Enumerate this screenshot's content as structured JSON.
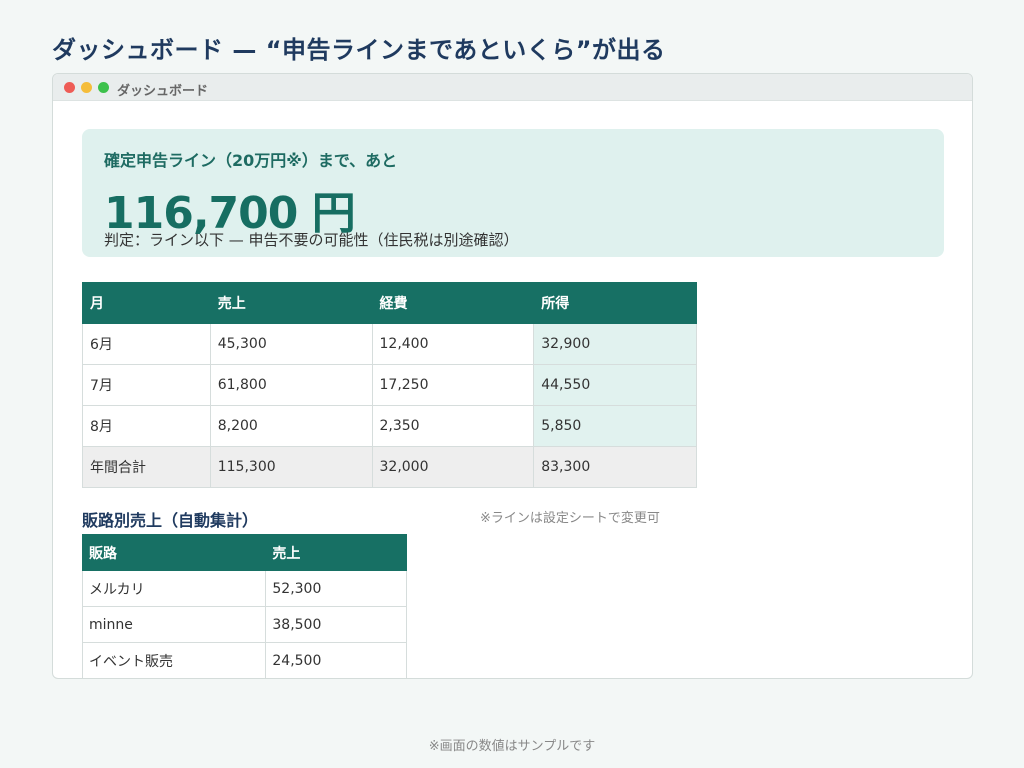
{
  "page_title": "ダッシュボード — “申告ラインまであといくら”が出る",
  "window": {
    "title": "ダッシュボード"
  },
  "summary": {
    "heading": "確定申告ライン（20万円※）まで、あと",
    "amount": "116,700 円",
    "note": "判定：ライン以下 — 申告不要の可能性（住民税は別途確認）"
  },
  "monthly_table": {
    "headers": [
      "月",
      "売上",
      "経費",
      "所得"
    ],
    "rows": [
      [
        "6月",
        "45,300",
        "12,400",
        "32,900"
      ],
      [
        "7月",
        "61,800",
        "17,250",
        "44,550"
      ],
      [
        "8月",
        "8,200",
        "2,350",
        "5,850"
      ]
    ],
    "total": [
      "年間合計",
      "115,300",
      "32,000",
      "83,300"
    ]
  },
  "channel_section": {
    "title": "販路別売上（自動集計）",
    "note": "※ラインは設定シートで変更可",
    "headers": [
      "販路",
      "売上"
    ],
    "rows": [
      [
        "メルカリ",
        "52,300"
      ],
      [
        "minne",
        "38,500"
      ],
      [
        "イベント販売",
        "24,500"
      ]
    ]
  },
  "footer_note": "※画面の数値はサンプルです",
  "colors": {
    "accent": "#177064",
    "summary_bg": "#dff1ee",
    "title": "#1f3a5f",
    "income_col_bg": "#e1f2ef",
    "total_row_bg": "#eeeeee"
  }
}
